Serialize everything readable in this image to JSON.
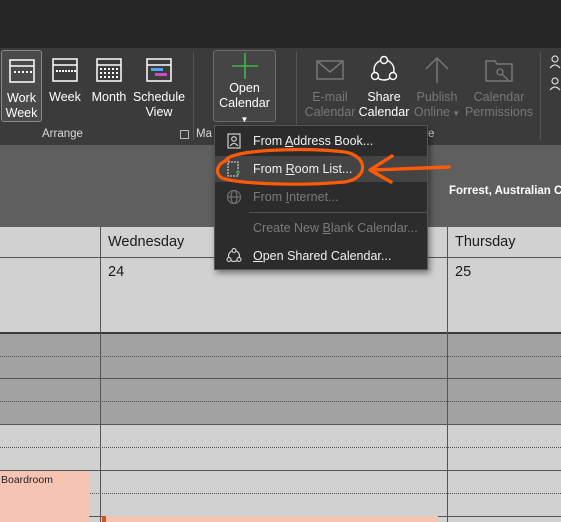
{
  "ribbon": {
    "buttons": [
      {
        "line1": "Work",
        "line2": "Week"
      },
      {
        "line1": "Week",
        "line2": ""
      },
      {
        "line1": "Month",
        "line2": ""
      },
      {
        "line1": "Schedule",
        "line2": "View"
      },
      {
        "line1": "Open",
        "line2": "Calendar"
      },
      {
        "line1": "E-mail",
        "line2": "Calendar"
      },
      {
        "line1": "Share",
        "line2": "Calendar"
      },
      {
        "line1": "Publish",
        "line2": "Online"
      },
      {
        "line1": "Calendar",
        "line2": "Permissions"
      }
    ],
    "groups": {
      "arrange": "Arrange",
      "manage_partial": "Ma",
      "share_partial": "e"
    }
  },
  "menu": {
    "items": [
      {
        "pre": "From ",
        "u": "A",
        "post": "ddress Book..."
      },
      {
        "pre": "From ",
        "u": "R",
        "post": "oom List..."
      },
      {
        "pre": "From ",
        "u": "I",
        "post": "nternet..."
      },
      {
        "pre": "Create New ",
        "u": "B",
        "post": "lank Calendar..."
      },
      {
        "pre": "",
        "u": "O",
        "post": "pen Shared Calendar..."
      }
    ]
  },
  "calendar": {
    "owner": "Forrest, Australian C",
    "days": [
      {
        "name": "Wednesday",
        "date": "24"
      },
      {
        "name": "Thursday",
        "date": "25"
      }
    ],
    "appointment": "Boardroom"
  },
  "colors": {
    "annotation": "#ff5a0a",
    "appointment": "#f6c4b2",
    "menu_bg": "#2c2c2c"
  }
}
